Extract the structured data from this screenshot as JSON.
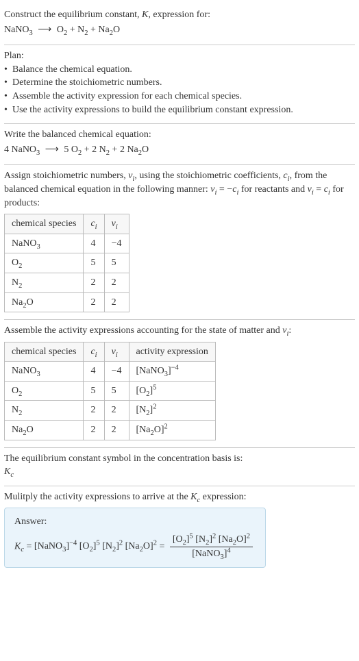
{
  "header": {
    "prompt": "Construct the equilibrium constant, ",
    "Ksym": "K",
    "prompt2": ", expression for:"
  },
  "rxn_unbalanced": {
    "lhs": "NaNO",
    "arrow": "⟶",
    "rhs_terms": [
      "O",
      "N",
      "Na",
      "O"
    ]
  },
  "plan": {
    "title": "Plan:",
    "items": [
      "Balance the chemical equation.",
      "Determine the stoichiometric numbers.",
      "Assemble the activity expression for each chemical species.",
      "Use the activity expressions to build the equilibrium constant expression."
    ]
  },
  "balanced": {
    "intro": "Write the balanced chemical equation:",
    "c_NaNO3": "4",
    "c_O2": "5",
    "c_N2": "2",
    "c_Na2O": "2"
  },
  "assign": {
    "text_a": "Assign stoichiometric numbers, ",
    "nu": "ν",
    "text_b": ", using the stoichiometric coefficients, ",
    "ci": "c",
    "text_c": ", from the balanced chemical equation in the following manner: ",
    "rel1a": "ν",
    "rel1b": " = −",
    "rel1c": "c",
    "text_d": " for reactants and ",
    "rel2a": "ν",
    "rel2b": " = ",
    "rel2c": "c",
    "text_e": " for products:"
  },
  "table1": {
    "h1": "chemical species",
    "h2": "c",
    "h2sub": "i",
    "h3": "ν",
    "h3sub": "i",
    "rows": [
      {
        "sp_a": "NaNO",
        "sp_sub": "3",
        "c": "4",
        "v": "−4"
      },
      {
        "sp_a": "O",
        "sp_sub": "2",
        "c": "5",
        "v": "5"
      },
      {
        "sp_a": "N",
        "sp_sub": "2",
        "c": "2",
        "v": "2"
      },
      {
        "sp_a": "Na",
        "sp_sub": "2",
        "sp_b": "O",
        "c": "2",
        "v": "2"
      }
    ]
  },
  "assemble": {
    "text_a": "Assemble the activity expressions accounting for the state of matter and ",
    "nu": "ν",
    "text_b": ":"
  },
  "table2": {
    "h1": "chemical species",
    "h2": "c",
    "h2sub": "i",
    "h3": "ν",
    "h3sub": "i",
    "h4": "activity expression",
    "rows": [
      {
        "sp_a": "NaNO",
        "sp_sub": "3",
        "c": "4",
        "v": "−4",
        "act_base": "[NaNO",
        "act_sub": "3",
        "act_close": "]",
        "act_exp": "−4"
      },
      {
        "sp_a": "O",
        "sp_sub": "2",
        "c": "5",
        "v": "5",
        "act_base": "[O",
        "act_sub": "2",
        "act_close": "]",
        "act_exp": "5"
      },
      {
        "sp_a": "N",
        "sp_sub": "2",
        "c": "2",
        "v": "2",
        "act_base": "[N",
        "act_sub": "2",
        "act_close": "]",
        "act_exp": "2"
      },
      {
        "sp_a": "Na",
        "sp_sub": "2",
        "sp_b": "O",
        "c": "2",
        "v": "2",
        "act_base": "[Na",
        "act_sub": "2",
        "act_mid": "O",
        "act_close": "]",
        "act_exp": "2"
      }
    ]
  },
  "kc_symbol": {
    "text": "The equilibrium constant symbol in the concentration basis is:",
    "K": "K",
    "sub": "c"
  },
  "multiply": {
    "text_a": "Mulitply the activity expressions to arrive at the ",
    "K": "K",
    "sub": "c",
    "text_b": " expression:"
  },
  "answer": {
    "label": "Answer:",
    "Kc": "K",
    "Kcsub": "c",
    "eq": " = ",
    "flat": {
      "t1": "[NaNO",
      "s1": "3",
      "c1": "]",
      "e1": "−4",
      "t2": " [O",
      "s2": "2",
      "c2": "]",
      "e2": "5",
      "t3": " [N",
      "s3": "2",
      "c3": "]",
      "e3": "2",
      "t4": " [Na",
      "s4": "2",
      "m4": "O",
      "c4": "]",
      "e4": "2"
    },
    "frac": {
      "num": {
        "t1": "[O",
        "s1": "2",
        "c1": "]",
        "e1": "5",
        "t2": " [N",
        "s2": "2",
        "c2": "]",
        "e2": "2",
        "t3": " [Na",
        "s3": "2",
        "m3": "O",
        "c3": "]",
        "e3": "2"
      },
      "den": {
        "t1": "[NaNO",
        "s1": "3",
        "c1": "]",
        "e1": "4"
      }
    }
  }
}
